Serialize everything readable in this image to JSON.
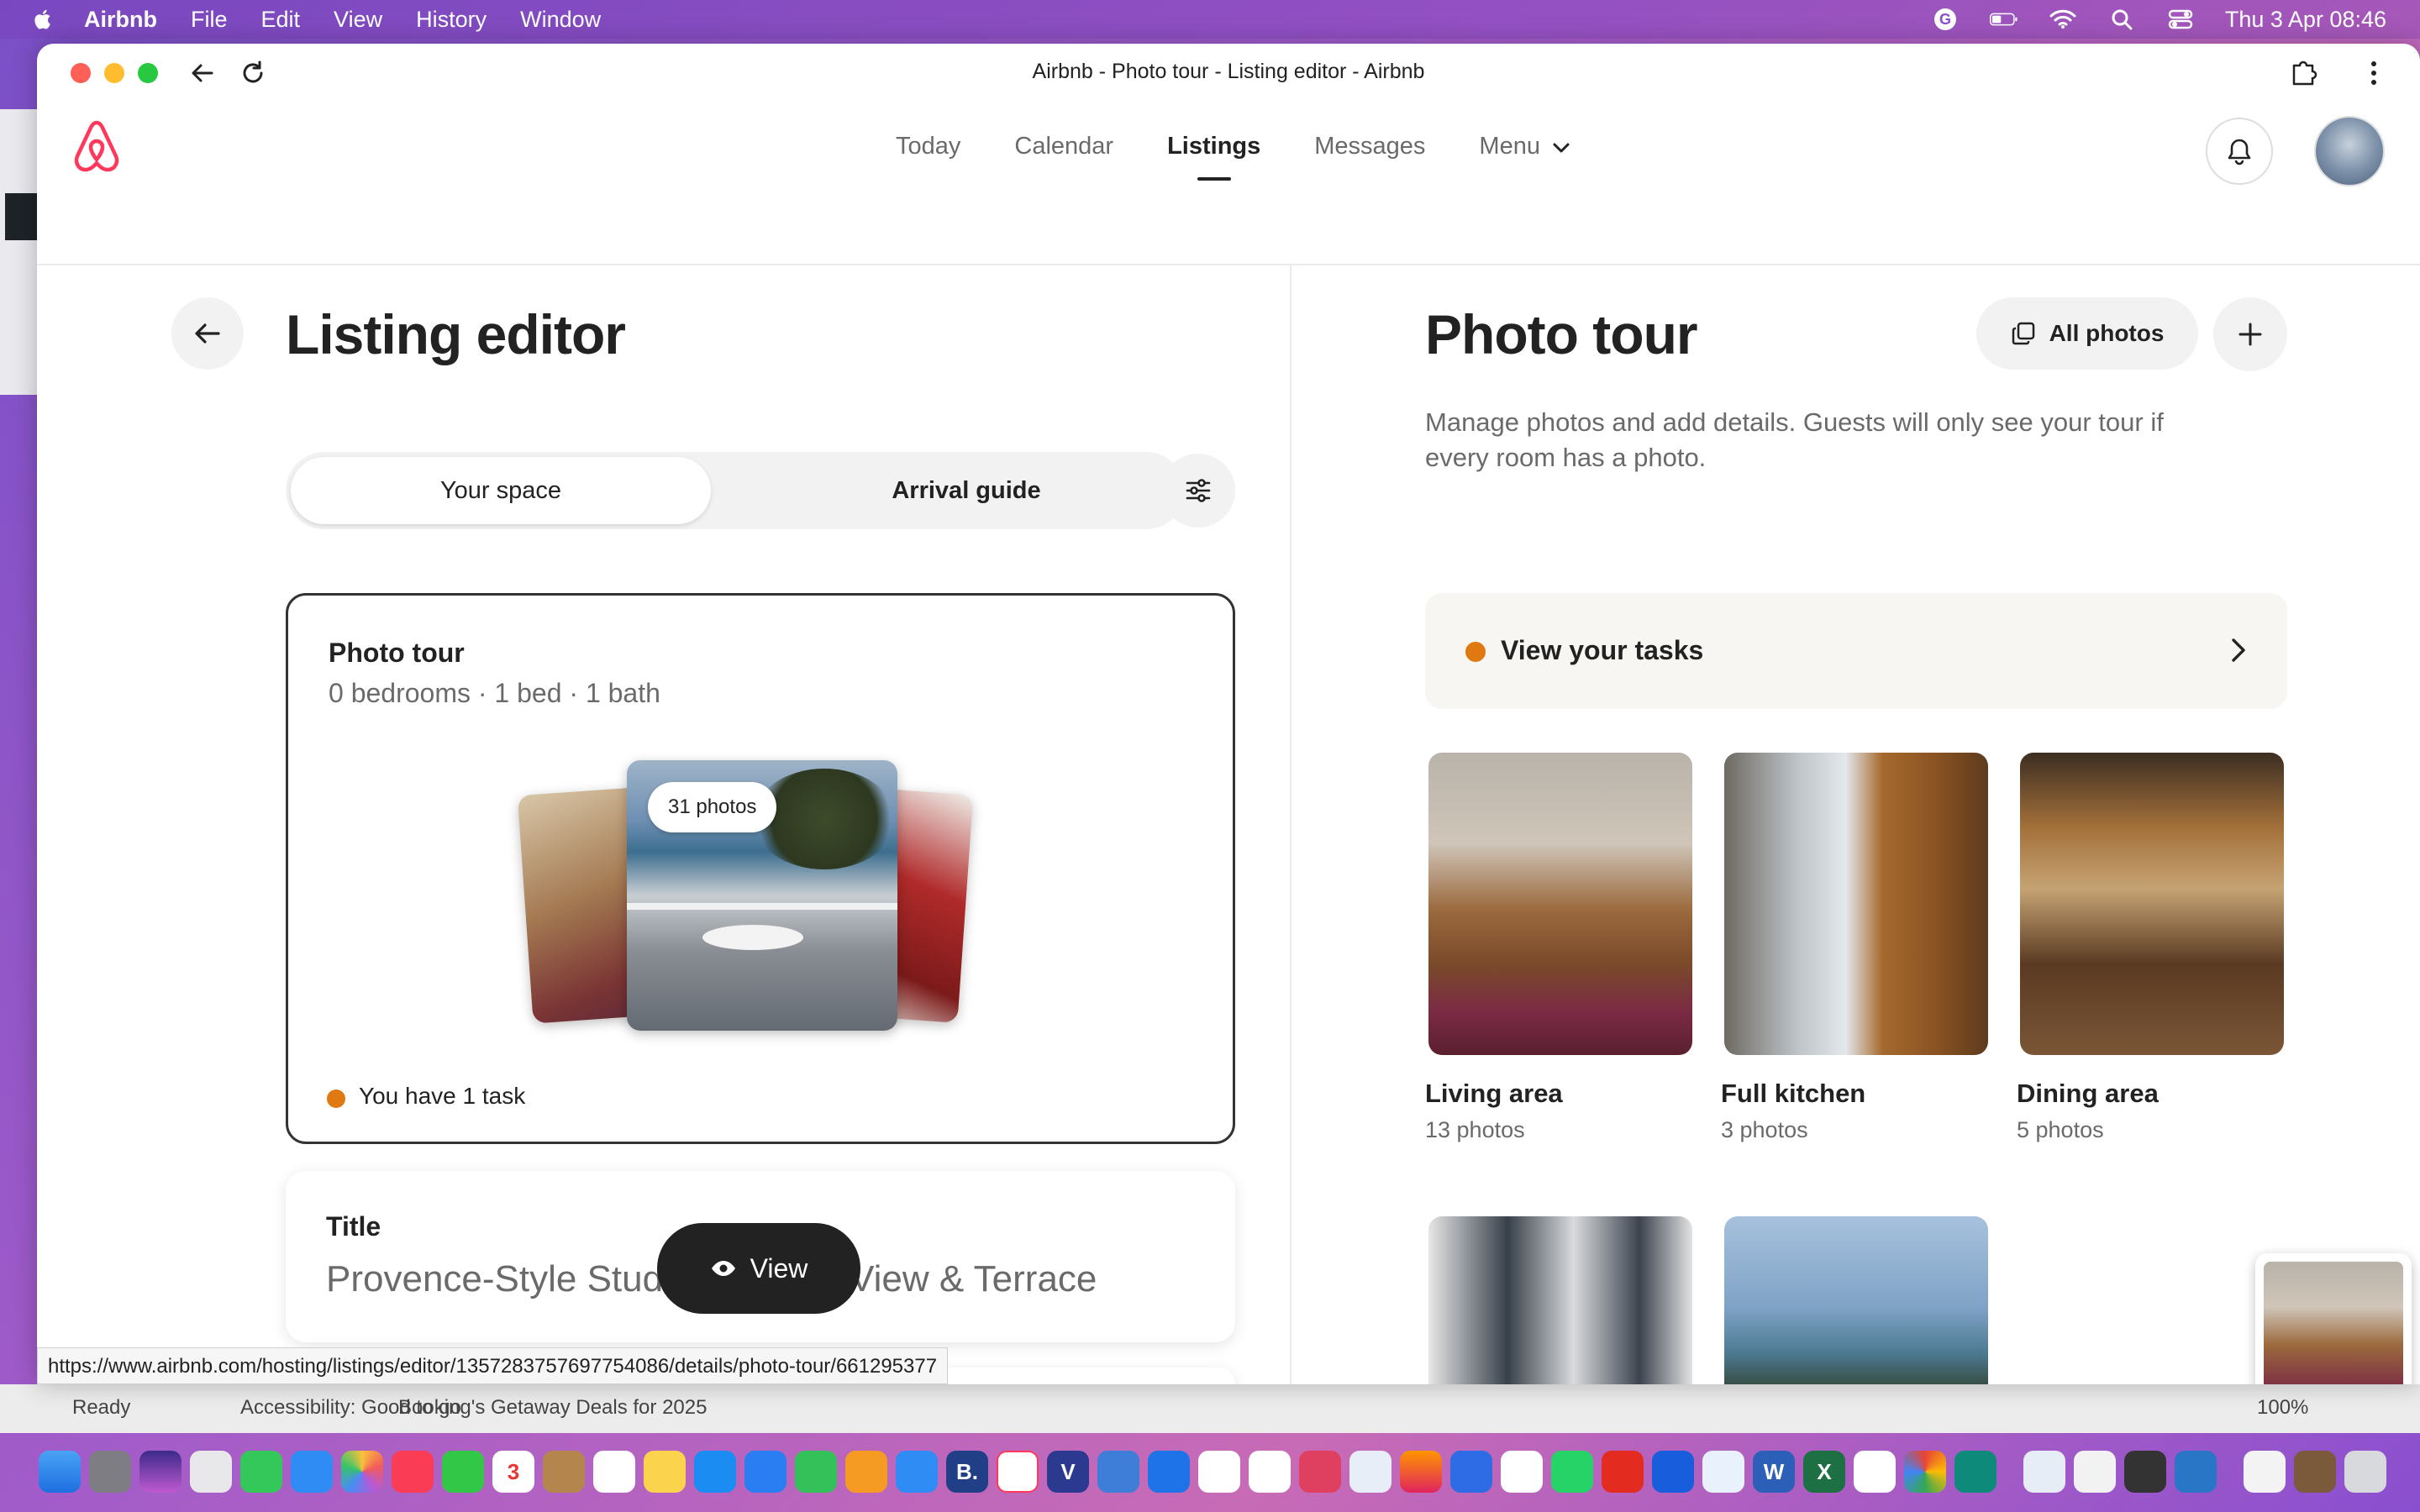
{
  "menubar": {
    "app": "Airbnb",
    "items": [
      "File",
      "Edit",
      "View",
      "History",
      "Window"
    ],
    "clock": "Thu 3 Apr  08:46"
  },
  "browser": {
    "title": "Airbnb - Photo tour - Listing editor - Airbnb",
    "status_url": "https://www.airbnb.com/hosting/listings/editor/1357283757697754086/details/photo-tour/661295377"
  },
  "nav": {
    "items": [
      {
        "label": "Today"
      },
      {
        "label": "Calendar"
      },
      {
        "label": "Listings"
      },
      {
        "label": "Messages"
      },
      {
        "label": "Menu"
      }
    ],
    "active": "Listings"
  },
  "left": {
    "title": "Listing editor",
    "tabs": [
      "Your space",
      "Arrival guide"
    ],
    "selected_tab": "Your space",
    "photo_card": {
      "title": "Photo tour",
      "summary": "0 bedrooms · 1 bed · 1 bath",
      "badge": "31 photos",
      "task": "You have 1 task"
    },
    "title_card": {
      "label": "Title",
      "value": "Provence-Style Stud",
      "value_tail": "View & Terrace"
    },
    "view_button": "View"
  },
  "right": {
    "title": "Photo tour",
    "all_photos": "All photos",
    "description": "Manage photos and add details. Guests will only see your tour if every room has a photo.",
    "tasks_link": "View your tasks",
    "rooms": [
      {
        "name": "Living area",
        "count": "13 photos"
      },
      {
        "name": "Full kitchen",
        "count": "3 photos"
      },
      {
        "name": "Dining area",
        "count": "5 photos"
      }
    ]
  },
  "background_window": {
    "status_left": "Ready",
    "status_access": "Accessibility: Good to go",
    "status_tab": "Booking's Getaway Deals for 2025",
    "zoom": "100%"
  },
  "colors": {
    "brand": "#FF385C",
    "task_dot": "#E07912",
    "dark_button": "#222222"
  }
}
